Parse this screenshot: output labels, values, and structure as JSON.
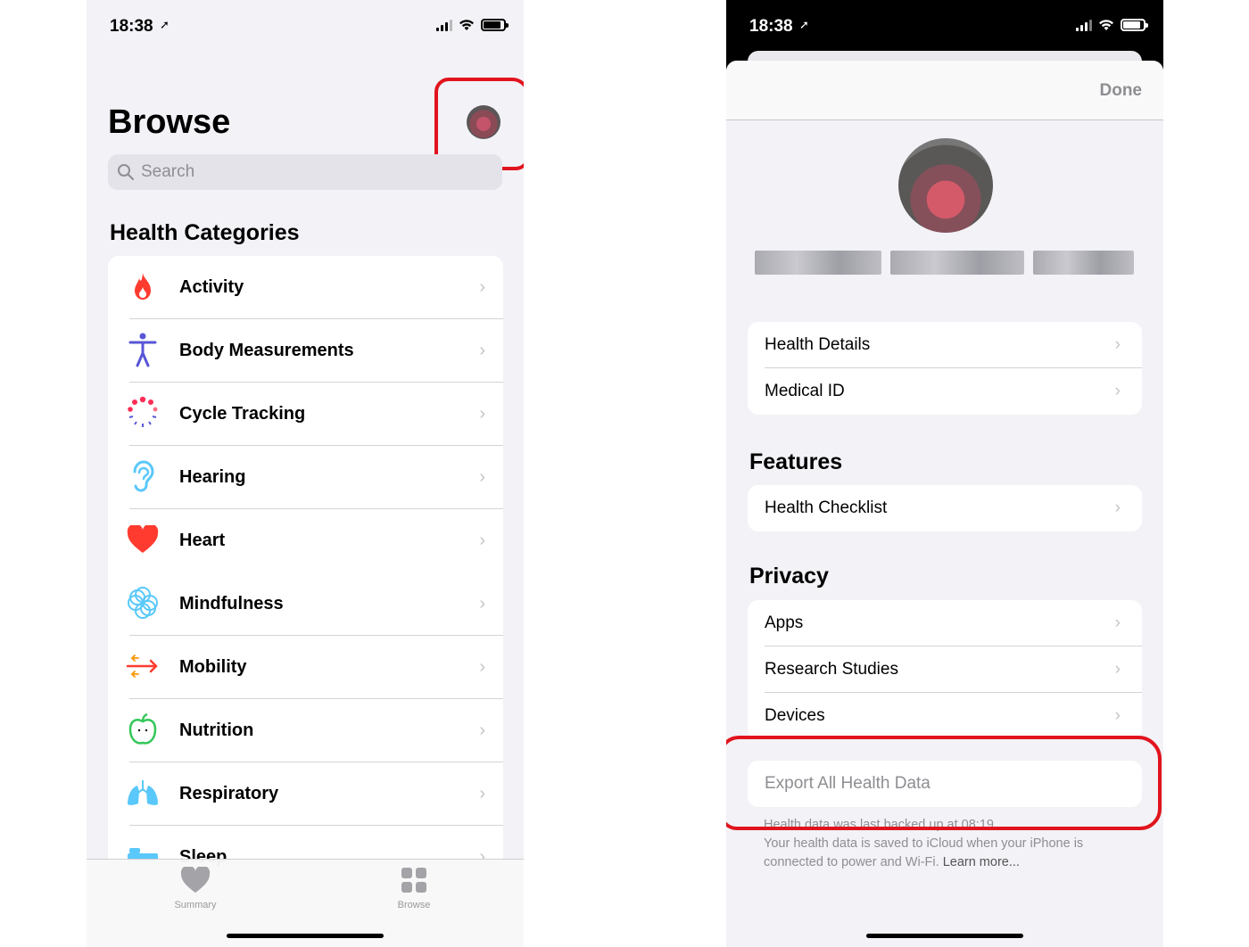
{
  "left": {
    "status": {
      "time": "18:38",
      "location_icon": "location-arrow-icon"
    },
    "title": "Browse",
    "search": {
      "placeholder": "Search",
      "icon": "search-icon"
    },
    "section_title": "Health Categories",
    "categories": [
      {
        "label": "Activity",
        "icon": "flame-icon",
        "color": "#ff3b30"
      },
      {
        "label": "Body Measurements",
        "icon": "person-figure-icon",
        "color": "#5856d6"
      },
      {
        "label": "Cycle Tracking",
        "icon": "cycle-dots-icon",
        "color": "#ff2d55"
      },
      {
        "label": "Hearing",
        "icon": "ear-icon",
        "color": "#5ac8fa"
      },
      {
        "label": "Heart",
        "icon": "heart-icon",
        "color": "#ff3b30"
      },
      {
        "label": "Mindfulness",
        "icon": "flower-icon",
        "color": "#64d2ff"
      },
      {
        "label": "Mobility",
        "icon": "arrows-icon",
        "color": "#ff9500"
      },
      {
        "label": "Nutrition",
        "icon": "apple-icon",
        "color": "#34c759"
      },
      {
        "label": "Respiratory",
        "icon": "lungs-icon",
        "color": "#5ac8fa"
      },
      {
        "label": "Sleep",
        "icon": "bed-icon",
        "color": "#5ac8fa"
      }
    ],
    "tabs": [
      {
        "label": "Summary",
        "icon": "heart-tab-icon"
      },
      {
        "label": "Browse",
        "icon": "grid-tab-icon"
      }
    ]
  },
  "right": {
    "status": {
      "time": "18:38",
      "location_icon": "location-arrow-icon"
    },
    "done_label": "Done",
    "profile_group": [
      {
        "label": "Health Details"
      },
      {
        "label": "Medical ID"
      }
    ],
    "features_title": "Features",
    "features_group": [
      {
        "label": "Health Checklist"
      }
    ],
    "privacy_title": "Privacy",
    "privacy_group": [
      {
        "label": "Apps"
      },
      {
        "label": "Research Studies"
      },
      {
        "label": "Devices"
      }
    ],
    "export_label": "Export All Health Data",
    "backup_note": "Health data was last backed up at 08:19.",
    "icloud_note": "Your health data is saved to iCloud when your iPhone is connected to power and Wi-Fi.",
    "learn_more": "Learn more..."
  },
  "colors": {
    "highlight": "#e1141d",
    "background": "#f2f2f7",
    "chevron": "#c4c4c7"
  }
}
